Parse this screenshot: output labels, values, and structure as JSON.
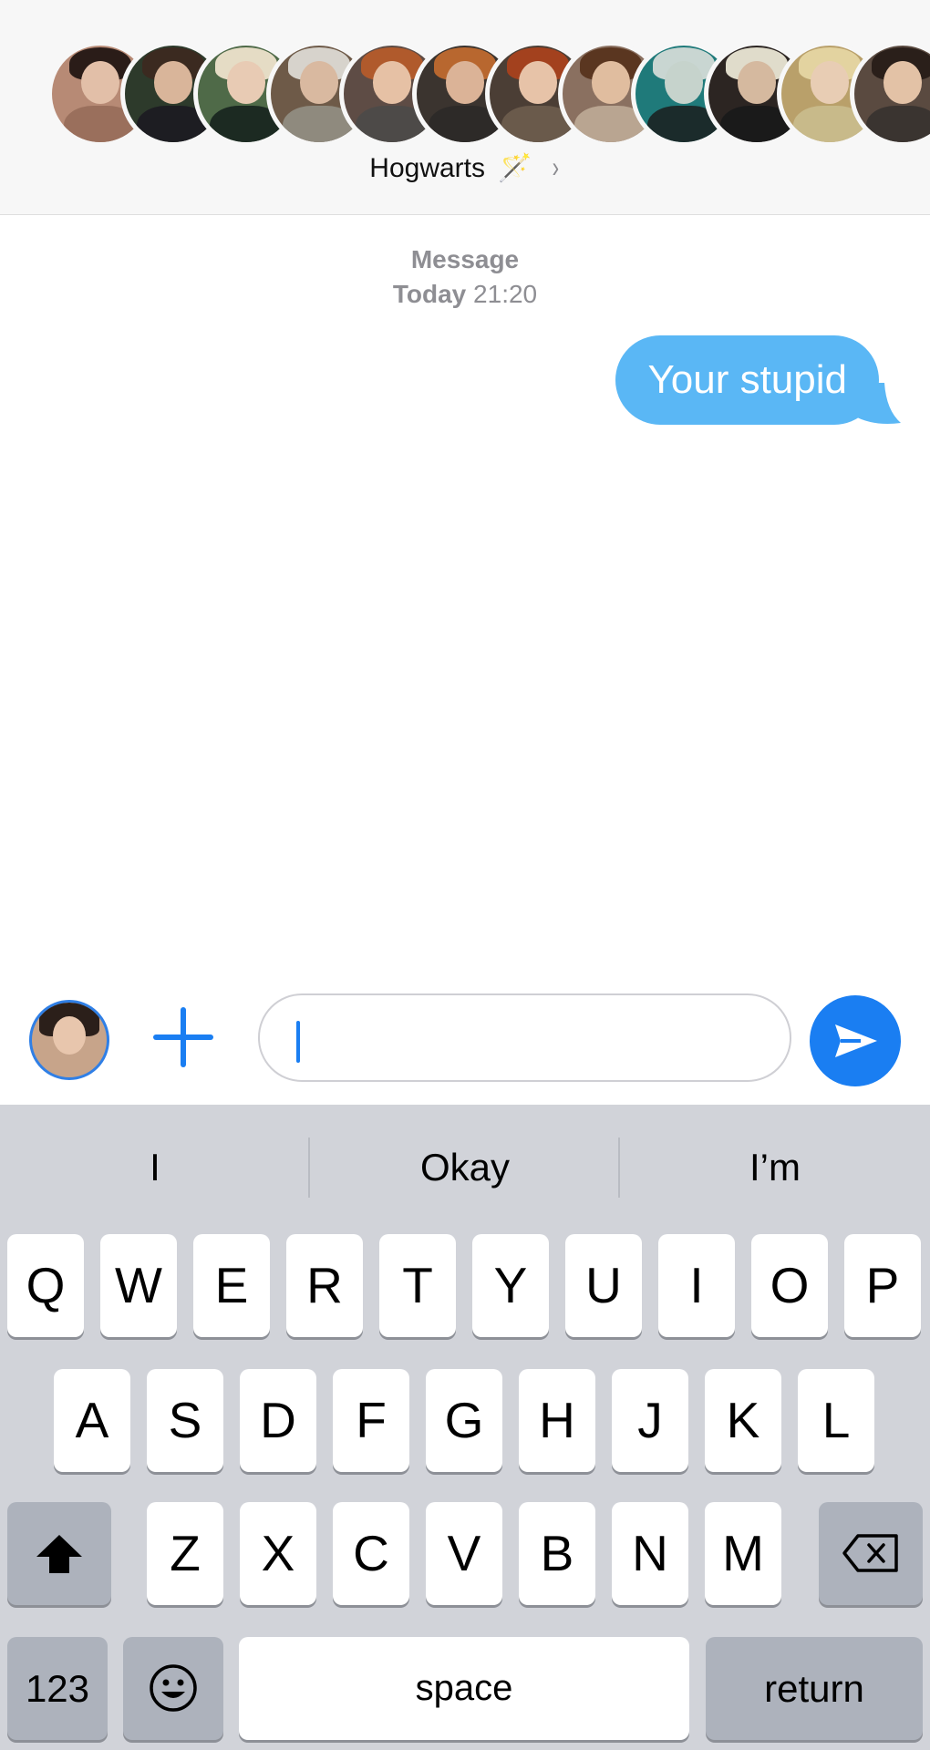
{
  "header": {
    "group_name": "Hogwarts",
    "wand_emoji": "🪄",
    "chevron": "›",
    "members": [
      {
        "icon": "member-avatar",
        "bg": "#b78a75",
        "hair": "#2a1c18",
        "skin": "#e2bfa8",
        "cloth": "#9a6f5c"
      },
      {
        "icon": "member-avatar",
        "bg": "#2d3a2b",
        "hair": "#3b2a20",
        "skin": "#d9b59a",
        "cloth": "#1d1d22"
      },
      {
        "icon": "member-avatar",
        "bg": "#4f6a48",
        "hair": "#e5dcc5",
        "skin": "#e8cbb4",
        "cloth": "#1c2a22"
      },
      {
        "icon": "member-avatar",
        "bg": "#6e5a48",
        "hair": "#d7d3cc",
        "skin": "#d9b9a0",
        "cloth": "#8f8a7e"
      },
      {
        "icon": "member-avatar",
        "bg": "#5e4c45",
        "hair": "#b05a2c",
        "skin": "#e6c1a5",
        "cloth": "#4d4a48"
      },
      {
        "icon": "member-avatar",
        "bg": "#3b342f",
        "hair": "#b8672f",
        "skin": "#dbb397",
        "cloth": "#2d2a28"
      },
      {
        "icon": "member-avatar",
        "bg": "#4b3e35",
        "hair": "#a3411e",
        "skin": "#e7c3a8",
        "cloth": "#6a5a4b"
      },
      {
        "icon": "member-avatar",
        "bg": "#8a7060",
        "hair": "#5a3620",
        "skin": "#e0bd9f",
        "cloth": "#b9a591"
      },
      {
        "icon": "member-avatar",
        "bg": "#1f7a7a",
        "hair": "#c9d6d2",
        "skin": "#c6d3cc",
        "cloth": "#1b2b2b"
      },
      {
        "icon": "member-avatar",
        "bg": "#2c2522",
        "hair": "#e0dccb",
        "skin": "#d5b99f",
        "cloth": "#1a1a1a"
      },
      {
        "icon": "member-avatar",
        "bg": "#b9a06a",
        "hair": "#e3d3a0",
        "skin": "#e8cdb4",
        "cloth": "#c8ba8a"
      },
      {
        "icon": "member-avatar",
        "bg": "#5a4a40",
        "hair": "#2a1f1a",
        "skin": "#e3c2a6",
        "cloth": "#3a3430"
      }
    ]
  },
  "thread": {
    "meta_label": "Message",
    "meta_day": "Today",
    "meta_time": "21:20",
    "messages": [
      {
        "text": "Your stupid",
        "direction": "outgoing"
      }
    ]
  },
  "composer": {
    "input_value": "",
    "accent": "#1a7ef2"
  },
  "keyboard": {
    "suggestions": [
      "I",
      "Okay",
      "I’m"
    ],
    "row1": [
      "Q",
      "W",
      "E",
      "R",
      "T",
      "Y",
      "U",
      "I",
      "O",
      "P"
    ],
    "row2": [
      "A",
      "S",
      "D",
      "F",
      "G",
      "H",
      "J",
      "K",
      "L"
    ],
    "row3": [
      "Z",
      "X",
      "C",
      "V",
      "B",
      "N",
      "M"
    ],
    "numbers_label": "123",
    "space_label": "space",
    "return_label": "return",
    "shift_icon": "shift-icon",
    "backspace_icon": "backspace-icon",
    "emoji_icon": "emoji-icon"
  }
}
